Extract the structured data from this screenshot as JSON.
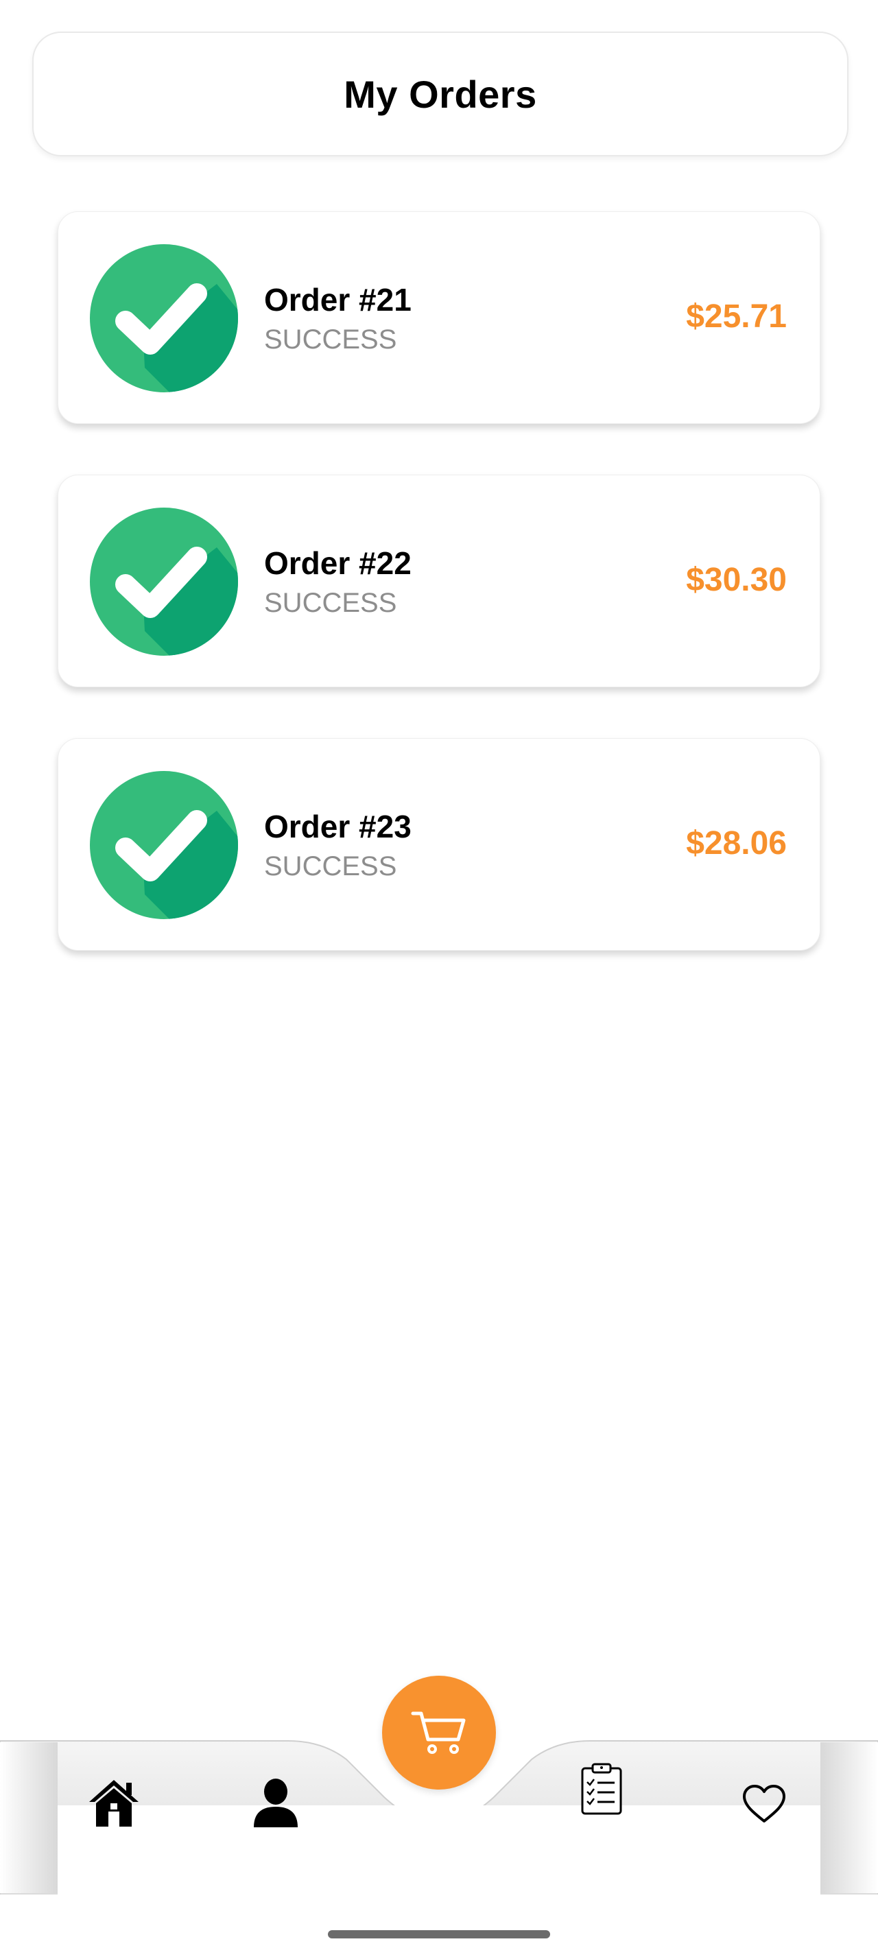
{
  "header": {
    "title": "My Orders"
  },
  "orders": [
    {
      "name": "Order #21",
      "status": "SUCCESS",
      "price": "$25.71"
    },
    {
      "name": "Order #22",
      "status": "SUCCESS",
      "price": "$30.30"
    },
    {
      "name": "Order #23",
      "status": "SUCCESS",
      "price": "$28.06"
    }
  ],
  "bottom_nav": {
    "items": [
      {
        "icon": "home-icon"
      },
      {
        "icon": "user-icon"
      },
      {
        "icon": "cart-icon"
      },
      {
        "icon": "clipboard-list-icon"
      },
      {
        "icon": "heart-icon"
      }
    ]
  },
  "colors": {
    "accent": "#F8922F",
    "price": "#F7902C",
    "success_green": "#34BC7B",
    "success_green_dark": "#0DA370",
    "status_gray": "#8D8D8D"
  }
}
